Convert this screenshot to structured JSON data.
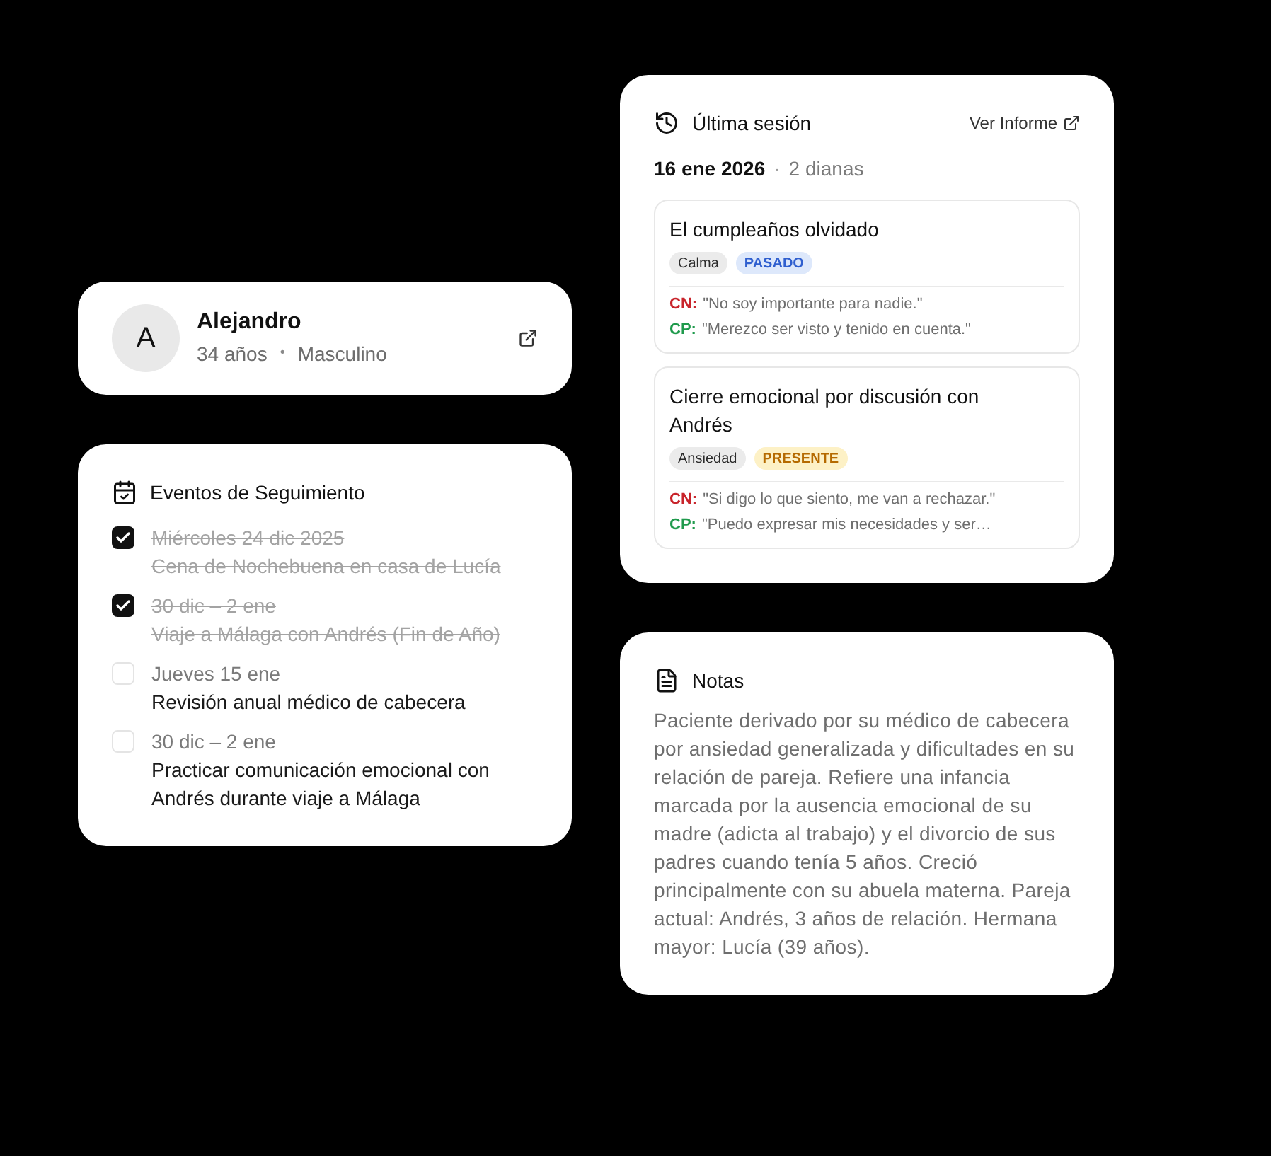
{
  "profile": {
    "initial": "A",
    "name": "Alejandro",
    "age": "34 años",
    "separator": "•",
    "gender": "Masculino"
  },
  "events": {
    "title": "Eventos de Seguimiento",
    "items": [
      {
        "date": "Miércoles 24 dic 2025",
        "title": "Cena de Nochebuena en casa de Lucía",
        "checked": true
      },
      {
        "date": "30 dic – 2 ene",
        "title": "Viaje a Málaga con Andrés (Fin de Año)",
        "checked": true
      },
      {
        "date": "Jueves 15 ene",
        "title": "Revisión anual médico de cabecera",
        "checked": false
      },
      {
        "date": "30 dic – 2 ene",
        "title": "Practicar comunicación emocional con Andrés durante viaje a Málaga",
        "checked": false
      }
    ]
  },
  "last_session": {
    "title": "Última sesión",
    "report_link": "Ver Informe",
    "date": "16 ene 2026",
    "separator": "·",
    "targets_count": "2 dianas",
    "targets": [
      {
        "title": "El cumpleaños olvidado",
        "tags": [
          {
            "label": "Calma",
            "kind": "emotion"
          },
          {
            "label": "PASADO",
            "kind": "past"
          }
        ],
        "thoughts": [
          {
            "label": "CN:",
            "text": "\"No soy importante para nadie.\"",
            "kind": "negative"
          },
          {
            "label": "CP:",
            "text": "\"Merezco ser visto y tenido en cuenta.\"",
            "kind": "positive"
          }
        ]
      },
      {
        "title": "Cierre emocional por discusión con Andrés",
        "tags": [
          {
            "label": "Ansiedad",
            "kind": "emotion"
          },
          {
            "label": "PRESENTE",
            "kind": "present"
          }
        ],
        "thoughts": [
          {
            "label": "CN:",
            "text": "\"Si digo lo que siento, me van a rechazar.\"",
            "kind": "negative"
          },
          {
            "label": "CP:",
            "text": "\"Puedo expresar mis necesidades y ser…",
            "kind": "positive"
          }
        ]
      }
    ]
  },
  "notes": {
    "title": "Notas",
    "text": "Paciente derivado por su médico de cabecera por ansiedad generalizada y dificultades en su relación de pareja. Refiere una infancia marcada por la ausencia emocional de su madre (adicta al trabajo) y el divorcio de sus padres cuando tenía 5 años. Creció principalmente con su abuela materna. Pareja actual: Andrés, 3 años de relación. Hermana mayor: Lucía (39 años)."
  }
}
